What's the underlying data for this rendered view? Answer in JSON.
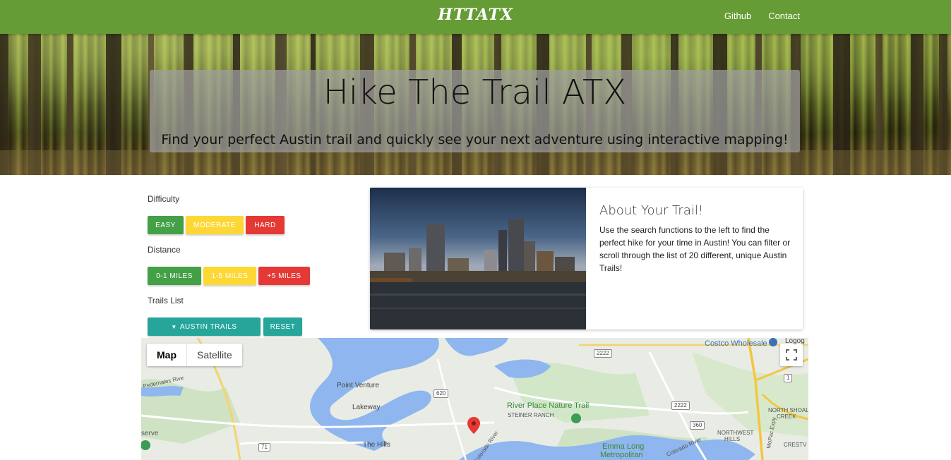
{
  "nav": {
    "brand": "HTTATX",
    "links": [
      "Github",
      "Contact"
    ]
  },
  "hero": {
    "title": "Hike The Trail ATX",
    "subtitle": "Find your perfect Austin trail and quickly see your next adventure using interactive mapping!"
  },
  "filters": {
    "difficulty_label": "Difficulty",
    "difficulty_buttons": [
      "EASY",
      "MODERATE",
      "HARD"
    ],
    "distance_label": "Distance",
    "distance_buttons": [
      "0-1 MILES",
      "1-5 MILES",
      "+5 MILES"
    ],
    "trails_label": "Trails List",
    "trails_dropdown": "AUSTIN TRAILS",
    "reset_label": "RESET"
  },
  "card": {
    "title": "About Your Trail!",
    "body": "Use the search functions to the left to find the perfect hike for your time in Austin! You can filter or scroll through the list of 20 different, unique Austin Trails!"
  },
  "map": {
    "type_options": [
      "Map",
      "Satellite"
    ],
    "selected_type": "Map",
    "labels": {
      "costco": "Costco Wholesale",
      "logo": "Logog",
      "point_venture": "Point Venture",
      "lakeway": "Lakeway",
      "river_place": "River Place Nature Trail",
      "steiner": "STEINER RANCH",
      "the_hills": "The Hills",
      "emma_long_1": "Emma Long",
      "emma_long_2": "Metropolitan",
      "north_shoal_1": "NORTH SHOAL",
      "north_shoal_2": "CREEK",
      "northwest_1": "NORTHWEST",
      "northwest_2": "HILLS",
      "crestv": "CRESTV",
      "pedernales": "Pedernales Rive",
      "serve": "serve",
      "colorado_1": "Colorado River",
      "colorado_2": "Colorado River",
      "mopac": "MoPac Expy"
    },
    "shields": [
      "2222",
      "620",
      "2222",
      "360",
      "71",
      "1"
    ]
  },
  "colors": {
    "nav": "#659c35",
    "easy": "#43a047",
    "moderate": "#fdd835",
    "hard": "#e53935",
    "teal": "#26a69a",
    "marker": "#e53935"
  }
}
